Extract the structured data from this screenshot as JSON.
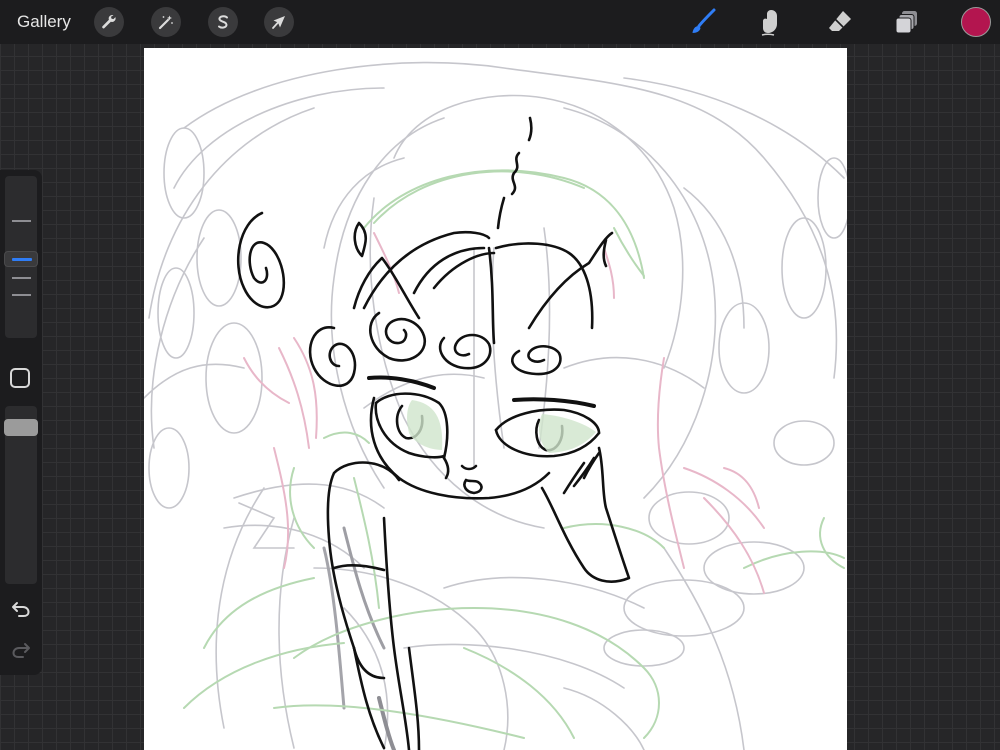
{
  "topbar": {
    "gallery_label": "Gallery",
    "left_tools": [
      {
        "name": "actions",
        "icon": "wrench-icon"
      },
      {
        "name": "adjustments",
        "icon": "magic-wand-icon"
      },
      {
        "name": "selection",
        "icon": "selection-s-icon"
      },
      {
        "name": "transform",
        "icon": "arrow-cursor-icon"
      }
    ],
    "right_tools": [
      {
        "name": "brush",
        "icon": "brush-icon",
        "active": true
      },
      {
        "name": "smudge",
        "icon": "smudge-finger-icon",
        "active": false
      },
      {
        "name": "eraser",
        "icon": "eraser-icon",
        "active": false
      },
      {
        "name": "layers",
        "icon": "layers-icon",
        "active": false
      }
    ],
    "current_color": "#b3154f"
  },
  "sidebar": {
    "brush_size_icon": "size-slider",
    "modify_icon": "square-icon",
    "undo_icon": "undo-arrow-icon",
    "redo_icon": "redo-arrow-icon"
  },
  "colors": {
    "active_tool": "#2f7df6",
    "tool_idle": "#d0d0d0",
    "sketch_gray": "#c6c6cc",
    "sketch_green": "#b6d9b2",
    "sketch_pink": "#e8b7c9",
    "ink": "#111111"
  }
}
